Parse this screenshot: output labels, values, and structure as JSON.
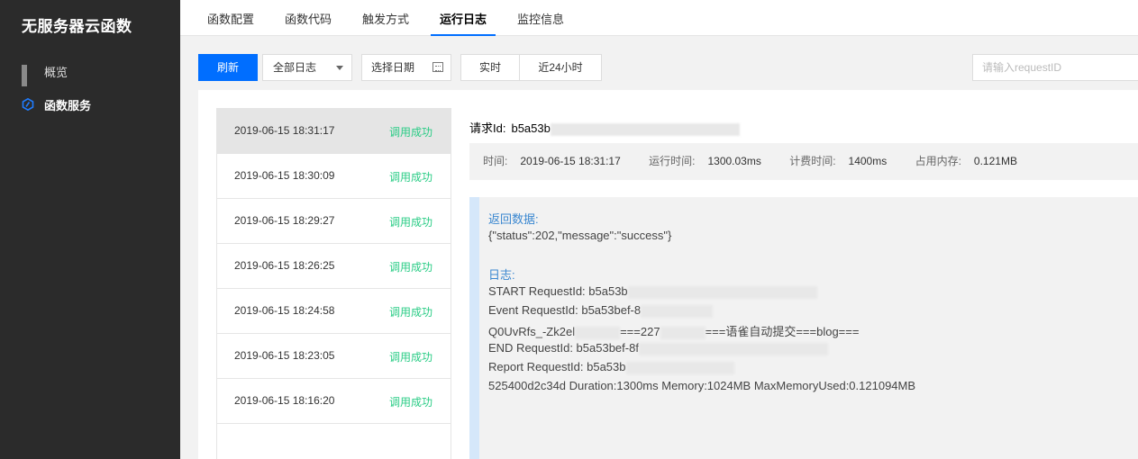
{
  "sidebar": {
    "app_title": "无服务器云函数",
    "items": [
      {
        "label": "概览",
        "icon": "grid-icon"
      },
      {
        "label": "函数服务",
        "icon": "function-icon"
      }
    ]
  },
  "tabs": [
    "函数配置",
    "函数代码",
    "触发方式",
    "运行日志",
    "监控信息"
  ],
  "active_tab": "运行日志",
  "toolbar": {
    "refresh_label": "刷新",
    "log_filter_value": "全部日志",
    "date_label": "选择日期",
    "realtime_label": "实时",
    "last24h_label": "近24小时",
    "search_placeholder": "请输入requestID"
  },
  "logs": [
    {
      "time": "2019-06-15 18:31:17",
      "status": "调用成功"
    },
    {
      "time": "2019-06-15 18:30:09",
      "status": "调用成功"
    },
    {
      "time": "2019-06-15 18:29:27",
      "status": "调用成功"
    },
    {
      "time": "2019-06-15 18:26:25",
      "status": "调用成功"
    },
    {
      "time": "2019-06-15 18:24:58",
      "status": "调用成功"
    },
    {
      "time": "2019-06-15 18:23:05",
      "status": "调用成功"
    },
    {
      "time": "2019-06-15 18:16:20",
      "status": "调用成功"
    }
  ],
  "detail": {
    "request_label": "请求Id:",
    "request_id_visible": "b5a53b",
    "meta": {
      "time_label": "时间:",
      "time_value": "2019-06-15 18:31:17",
      "run_label": "运行时间:",
      "run_value": "1300.03ms",
      "bill_label": "计费时间:",
      "bill_value": "1400ms",
      "mem_label": "占用内存:",
      "mem_value": "0.121MB"
    },
    "return_title": "返回数据:",
    "return_value": "{\"status\":202,\"message\":\"success\"}",
    "log_title": "日志:",
    "log_lines": [
      "START RequestId: b5a53b",
      "Event RequestId: b5a53bef-8",
      "Q0UvRfs_-Zk2el",
      "===227",
      "===语雀自动提交===blog===",
      "END RequestId: b5a53bef-8f",
      "Report RequestId: b5a53b",
      "525400d2c34d Duration:1300ms Memory:1024MB MaxMemoryUsed:0.121094MB"
    ]
  },
  "colors": {
    "sidebar_bg": "#2b2b2b",
    "primary": "#006eff",
    "success": "#29cc85",
    "section_title": "#3a87d0"
  }
}
